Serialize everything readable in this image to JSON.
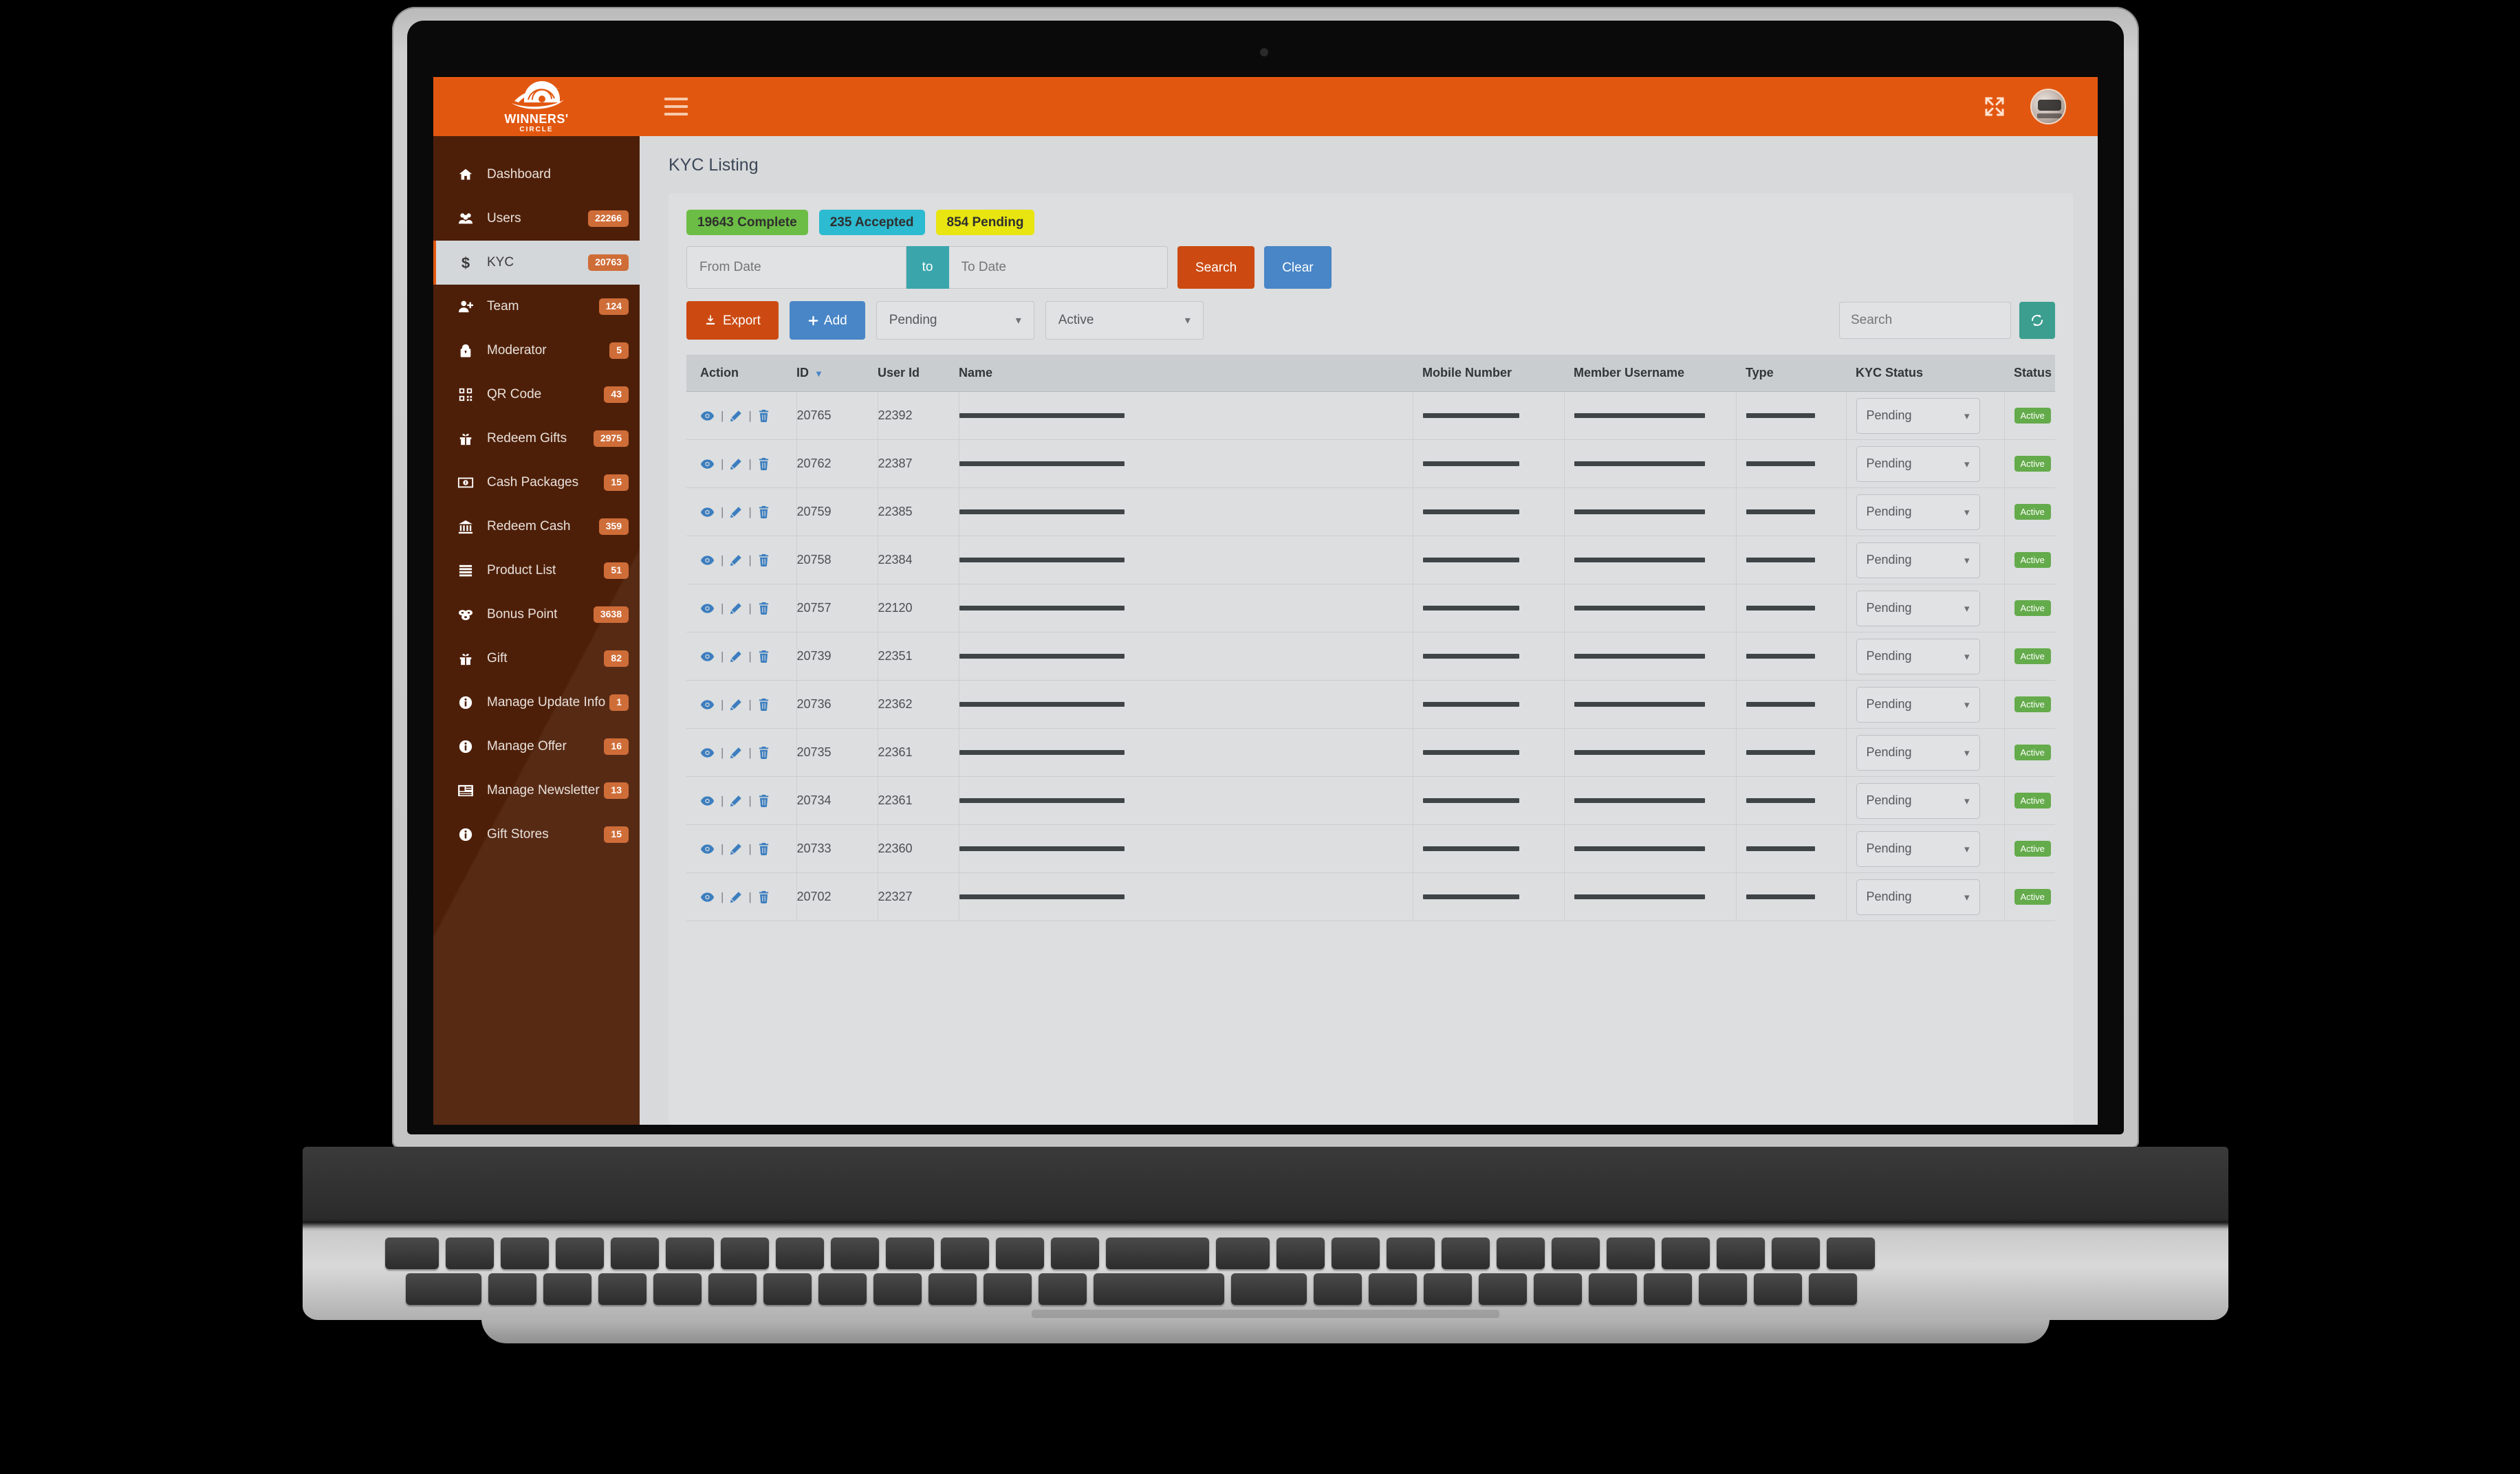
{
  "brand": {
    "name": "WINNERS'",
    "sub": "CIRCLE",
    "logo_icon": "helmet-logo-icon"
  },
  "topbar": {
    "menu_toggle_icon": "hamburger-menu-icon",
    "fullscreen_icon": "fullscreen-expand-icon",
    "avatar_icon": "user-avatar"
  },
  "sidebar": {
    "items": [
      {
        "label": "Dashboard",
        "badge": "",
        "icon": "home-icon",
        "active": false
      },
      {
        "label": "Users",
        "badge": "22266",
        "icon": "users-icon",
        "active": false
      },
      {
        "label": "KYC",
        "badge": "20763",
        "icon": "dollar-icon",
        "active": true
      },
      {
        "label": "Team",
        "badge": "124",
        "icon": "user-add-icon",
        "active": false
      },
      {
        "label": "Moderator",
        "badge": "5",
        "icon": "moderator-icon",
        "active": false
      },
      {
        "label": "QR Code",
        "badge": "43",
        "icon": "qr-code-icon",
        "active": false
      },
      {
        "label": "Redeem Gifts",
        "badge": "2975",
        "icon": "gift-icon",
        "active": false
      },
      {
        "label": "Cash Packages",
        "badge": "15",
        "icon": "money-bill-icon",
        "active": false
      },
      {
        "label": "Redeem Cash",
        "badge": "359",
        "icon": "bank-icon",
        "active": false
      },
      {
        "label": "Product List",
        "badge": "51",
        "icon": "list-icon",
        "active": false
      },
      {
        "label": "Bonus Point",
        "badge": "3638",
        "icon": "coins-icon",
        "active": false
      },
      {
        "label": "Gift",
        "badge": "82",
        "icon": "gift-icon",
        "active": false
      },
      {
        "label": "Manage Update Info",
        "badge": "1",
        "icon": "info-circle-icon",
        "active": false
      },
      {
        "label": "Manage Offer",
        "badge": "16",
        "icon": "info-circle-icon",
        "active": false
      },
      {
        "label": "Manage Newsletter",
        "badge": "13",
        "icon": "newspaper-icon",
        "active": false
      },
      {
        "label": "Gift Stores",
        "badge": "15",
        "icon": "info-circle-icon",
        "active": false
      }
    ]
  },
  "page": {
    "title": "KYC Listing"
  },
  "stats": [
    {
      "label": "19643 Complete",
      "color": "#6cbd45"
    },
    {
      "label": "235 Accepted",
      "color": "#2cbbd1"
    },
    {
      "label": "854 Pending",
      "color": "#e8e510"
    }
  ],
  "filters": {
    "from_date_placeholder": "From Date",
    "to_date_placeholder": "To Date",
    "from_date_value": "",
    "to_date_value": "",
    "separator_label": "to",
    "search_label": "Search",
    "clear_label": "Clear"
  },
  "toolbar": {
    "export_label": "Export",
    "export_icon": "download-icon",
    "add_label": "Add",
    "add_icon": "plus-icon",
    "kyc_filter_value": "Pending",
    "status_filter_value": "Active",
    "table_search_placeholder": "Search",
    "table_search_value": "",
    "refresh_icon": "refresh-icon"
  },
  "table": {
    "columns": [
      {
        "key": "action",
        "label": "Action",
        "sort": "none"
      },
      {
        "key": "id",
        "label": "ID",
        "sort": "desc"
      },
      {
        "key": "userid",
        "label": "User Id",
        "sort": "none"
      },
      {
        "key": "name",
        "label": "Name",
        "sort": "none"
      },
      {
        "key": "mobile",
        "label": "Mobile Number",
        "sort": "none"
      },
      {
        "key": "member",
        "label": "Member Username",
        "sort": "none"
      },
      {
        "key": "type",
        "label": "Type",
        "sort": "none"
      },
      {
        "key": "kyc",
        "label": "KYC Status",
        "sort": "none"
      },
      {
        "key": "status",
        "label": "Status",
        "sort": "both"
      }
    ],
    "action_icons": [
      "view-eye-icon",
      "edit-pencil-icon",
      "delete-trash-icon"
    ],
    "rows": [
      {
        "id": "20765",
        "userid": "22392",
        "name": "",
        "mobile": "",
        "member": "",
        "type": "",
        "kyc": "Pending",
        "status": "Active"
      },
      {
        "id": "20762",
        "userid": "22387",
        "name": "",
        "mobile": "",
        "member": "",
        "type": "",
        "kyc": "Pending",
        "status": "Active"
      },
      {
        "id": "20759",
        "userid": "22385",
        "name": "",
        "mobile": "",
        "member": "",
        "type": "",
        "kyc": "Pending",
        "status": "Active"
      },
      {
        "id": "20758",
        "userid": "22384",
        "name": "",
        "mobile": "",
        "member": "",
        "type": "",
        "kyc": "Pending",
        "status": "Active"
      },
      {
        "id": "20757",
        "userid": "22120",
        "name": "",
        "mobile": "",
        "member": "",
        "type": "",
        "kyc": "Pending",
        "status": "Active"
      },
      {
        "id": "20739",
        "userid": "22351",
        "name": "",
        "mobile": "",
        "member": "",
        "type": "",
        "kyc": "Pending",
        "status": "Active"
      },
      {
        "id": "20736",
        "userid": "22362",
        "name": "",
        "mobile": "",
        "member": "",
        "type": "",
        "kyc": "Pending",
        "status": "Active"
      },
      {
        "id": "20735",
        "userid": "22361",
        "name": "",
        "mobile": "",
        "member": "",
        "type": "",
        "kyc": "Pending",
        "status": "Active"
      },
      {
        "id": "20734",
        "userid": "22361",
        "name": "",
        "mobile": "",
        "member": "",
        "type": "",
        "kyc": "Pending",
        "status": "Active"
      },
      {
        "id": "20733",
        "userid": "22360",
        "name": "",
        "mobile": "",
        "member": "",
        "type": "",
        "kyc": "Pending",
        "status": "Active"
      },
      {
        "id": "20702",
        "userid": "22327",
        "name": "",
        "mobile": "",
        "member": "",
        "type": "",
        "kyc": "Pending",
        "status": "Active"
      }
    ]
  },
  "colors": {
    "brand_orange": "#e2570f",
    "sidebar_brown": "#4e1f08",
    "badge_orange": "#cf6d38",
    "danger_orange": "#cc4a12",
    "primary_blue": "#4886c7",
    "teal": "#3aa6ac",
    "refresh_teal": "#3b9e8f",
    "active_green": "#64ab4b"
  }
}
